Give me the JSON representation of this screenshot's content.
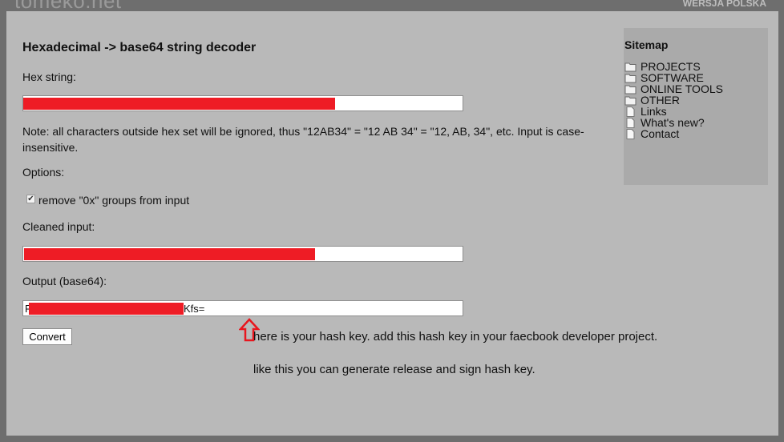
{
  "site": {
    "logo_text": "tomeko.net",
    "language_link": "WERSJA POLSKA"
  },
  "main": {
    "title": "Hexadecimal -> base64 string decoder",
    "hex_label": "Hex string:",
    "note": "Note: all characters outside hex set will be ignored, thus \"12AB34\" = \"12 AB 34\" = \"12, AB, 34\", etc. Input is case-insensitive.",
    "options_label": "Options:",
    "remove_0x_label": "remove \"0x\" groups from input",
    "remove_0x_checked": true,
    "cleaned_label": "Cleaned input:",
    "output_label": "Output (base64):",
    "output_visible_prefix": "R",
    "output_visible_suffix": "Kfs=",
    "convert_button": "Convert"
  },
  "annotations": {
    "line1": "here is your hash key. add this hash key in your faecbook developer project.",
    "line2": "like this you can generate release and sign hash key.",
    "arrow_color": "#e8161e"
  },
  "sitemap": {
    "title": "Sitemap",
    "items": [
      {
        "label": "PROJECTS",
        "icon": "folder-icon"
      },
      {
        "label": "SOFTWARE",
        "icon": "folder-icon"
      },
      {
        "label": "ONLINE TOOLS",
        "icon": "folder-icon"
      },
      {
        "label": "OTHER",
        "icon": "folder-icon"
      },
      {
        "label": "Links",
        "icon": "page-icon"
      },
      {
        "label": "What's new?",
        "icon": "page-icon"
      },
      {
        "label": "Contact",
        "icon": "page-icon"
      }
    ]
  },
  "colors": {
    "background": "#6e6e6e",
    "panel": "#b9b9b9",
    "sidebar": "#aaaaaa",
    "redaction": "#ee1c25"
  }
}
